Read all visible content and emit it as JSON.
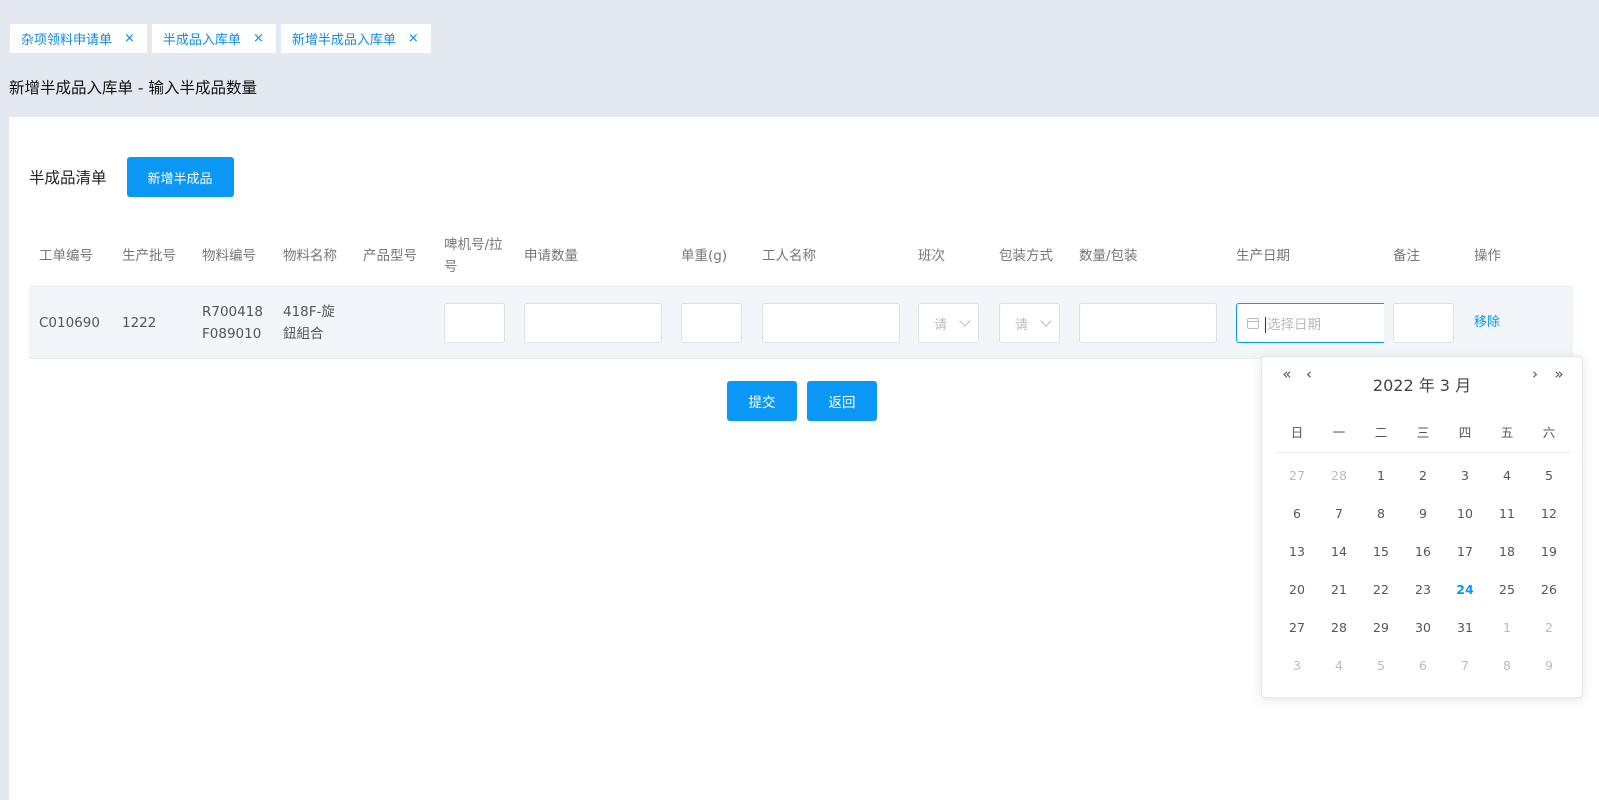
{
  "tabs": [
    {
      "label": "杂项领料申请单",
      "close": "×"
    },
    {
      "label": "半成品入库单",
      "close": "×"
    },
    {
      "label": "新增半成品入库单",
      "close": "×"
    }
  ],
  "page_title": "新增半成品入库单 - 输入半成品数量",
  "list": {
    "title": "半成品清单",
    "add_button": "新增半成品"
  },
  "table": {
    "headers": {
      "order_no": "工单编号",
      "batch_no": "生产批号",
      "material_code": "物料编号",
      "material_name": "物料名称",
      "product_model": "产品型号",
      "machine_no": "啤机号/拉号",
      "apply_qty": "申请数量",
      "unit_weight": "单重(g)",
      "worker_name": "工人名称",
      "shift": "班次",
      "packing": "包装方式",
      "qty_per_pack": "数量/包装",
      "prod_date": "生产日期",
      "remark": "备注",
      "action": "操作"
    },
    "row": {
      "order_no": "C010690",
      "batch_no": "1222",
      "material_code": "R700418F089010",
      "material_name": "418F-旋鈕組合",
      "shift_placeholder": "请",
      "packing_placeholder": "请",
      "date_placeholder": "选择日期",
      "action": "移除"
    }
  },
  "buttons": {
    "submit": "提交",
    "back": "返回"
  },
  "datepicker": {
    "label": "2022 年  3 月",
    "nav_prev_year": "«",
    "nav_prev_month": "‹",
    "nav_next_month": "›",
    "nav_next_year": "»",
    "weekdays": [
      "日",
      "一",
      "二",
      "三",
      "四",
      "五",
      "六"
    ],
    "days": [
      {
        "d": "27",
        "m": true
      },
      {
        "d": "28",
        "m": true
      },
      {
        "d": "1"
      },
      {
        "d": "2"
      },
      {
        "d": "3"
      },
      {
        "d": "4"
      },
      {
        "d": "5"
      },
      {
        "d": "6"
      },
      {
        "d": "7"
      },
      {
        "d": "8"
      },
      {
        "d": "9"
      },
      {
        "d": "10"
      },
      {
        "d": "11"
      },
      {
        "d": "12"
      },
      {
        "d": "13"
      },
      {
        "d": "14"
      },
      {
        "d": "15"
      },
      {
        "d": "16"
      },
      {
        "d": "17"
      },
      {
        "d": "18"
      },
      {
        "d": "19"
      },
      {
        "d": "20"
      },
      {
        "d": "21"
      },
      {
        "d": "22"
      },
      {
        "d": "23"
      },
      {
        "d": "24",
        "today": true
      },
      {
        "d": "25"
      },
      {
        "d": "26"
      },
      {
        "d": "27"
      },
      {
        "d": "28"
      },
      {
        "d": "29"
      },
      {
        "d": "30"
      },
      {
        "d": "31"
      },
      {
        "d": "1",
        "m": true
      },
      {
        "d": "2",
        "m": true
      },
      {
        "d": "3",
        "m": true
      },
      {
        "d": "4",
        "m": true
      },
      {
        "d": "5",
        "m": true
      },
      {
        "d": "6",
        "m": true
      },
      {
        "d": "7",
        "m": true
      },
      {
        "d": "8",
        "m": true
      },
      {
        "d": "9",
        "m": true
      }
    ]
  },
  "colors": {
    "primary": "#0a97f5",
    "background": "#e4e9f1",
    "row_bg": "#f2f5f9"
  }
}
